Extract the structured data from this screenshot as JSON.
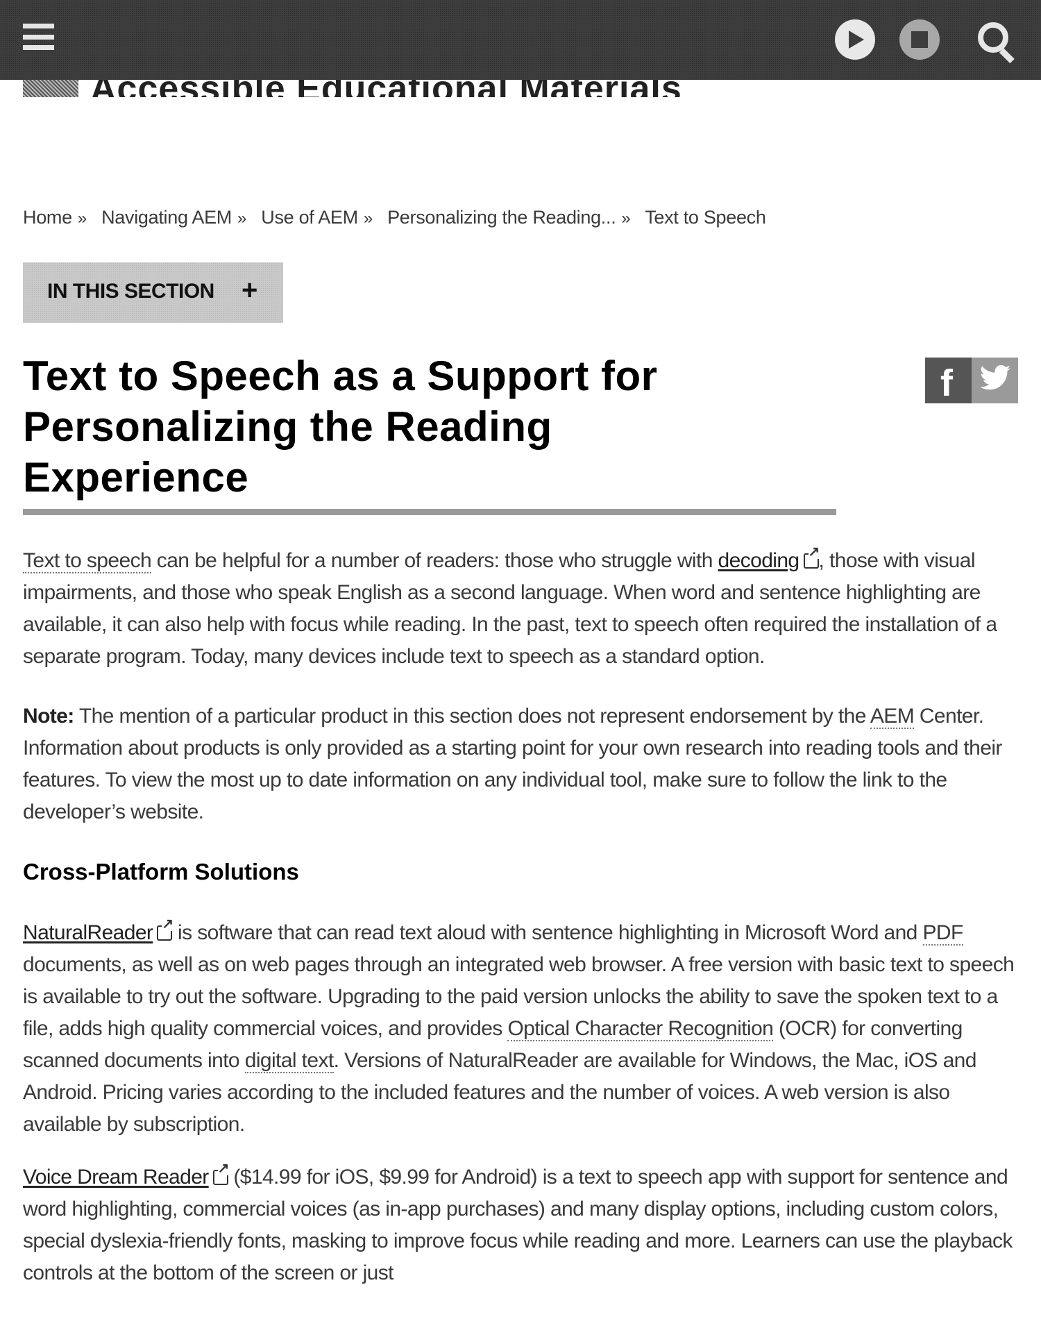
{
  "header": {
    "menu_icon": "hamburger-menu-icon",
    "play_icon": "play-icon",
    "stop_icon": "stop-icon",
    "search_icon": "search-icon",
    "logo_text": "Accessible Educational Materials"
  },
  "breadcrumb": {
    "items": [
      "Home",
      "Navigating AEM",
      "Use of AEM",
      "Personalizing the Reading...",
      "Text to Speech"
    ],
    "separator": "»"
  },
  "section_button": {
    "label": "IN THIS SECTION",
    "icon": "+"
  },
  "page": {
    "title": "Text to Speech as a Support for Personalizing the Reading Experience"
  },
  "social": {
    "facebook": "f",
    "twitter": "🐦"
  },
  "content": {
    "intro": {
      "abbr_text": "Text to speech",
      "part1": " can be helpful for a number of readers: those who struggle with ",
      "link_decoding": "decoding",
      "part2": ", those with visual impairments, and those who speak English as a second language. When word and sentence highlighting are available, it can also help with focus while reading. In the past, text to speech often required the installation of a separate program. Today, many devices include text to speech as a standard option."
    },
    "note": {
      "label": "Note:",
      "part1": " The mention of a particular product  in this section does not represent endorsement by the ",
      "abbr_aem": "AEM",
      "part2": " Center. Information about products is only provided as a starting point for your own research into reading tools and their features. To view the most up to date information on any individual tool, make sure to follow the link to the developer’s website."
    },
    "heading_cross_platform": "Cross-Platform Solutions",
    "natural_reader": {
      "link": "NaturalReader",
      "part1": " is software that can read text aloud with sentence highlighting in Microsoft Word and ",
      "abbr_pdf": "PDF",
      "part2": " documents, as well as on web pages through an integrated web browser.  A free version with basic text to speech is available to try out the software. Upgrading to the paid version unlocks the ability to save the spoken text to a file, adds high quality commercial voices, and provides ",
      "abbr_ocr": "Optical Character Recognition",
      "part3": " (OCR) for converting scanned documents into ",
      "abbr_digital": "digital text",
      "part4": ". Versions of NaturalReader are available for Windows, the Mac, iOS and Android. Pricing varies according to the included features and the number of voices. A web version is also available by subscription."
    },
    "voice_dream": {
      "link": "Voice Dream Reader",
      "part1": " ($14.99 for iOS, $9.99 for Android) is a text to speech app with support for sentence and word highlighting, commercial voices (as in-app purchases) and many display options, including custom colors, special dyslexia-friendly fonts, masking to improve focus while reading and more. Learners can use the playback controls at the bottom of the screen or just"
    }
  }
}
